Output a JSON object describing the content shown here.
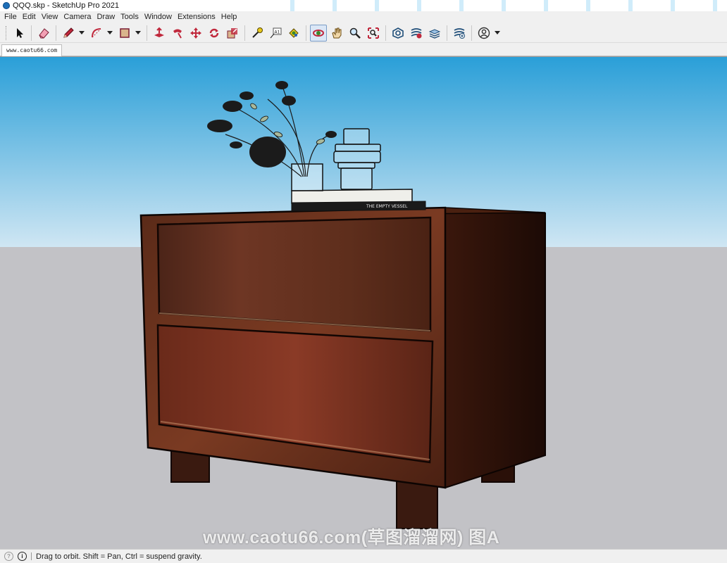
{
  "window": {
    "title": "QQQ.skp - SketchUp Pro 2021"
  },
  "menu": [
    "File",
    "Edit",
    "View",
    "Camera",
    "Draw",
    "Tools",
    "Window",
    "Extensions",
    "Help"
  ],
  "toolbar": {
    "tools": [
      "select",
      "eraser",
      "line",
      "arc",
      "shape",
      "push-pull",
      "follow-me",
      "move",
      "rotate",
      "scale",
      "tape-measure",
      "text",
      "paint-bucket",
      "orbit",
      "pan",
      "zoom",
      "zoom-extents",
      "3d-warehouse",
      "extension-warehouse",
      "layout",
      "extension-manager",
      "account"
    ],
    "active_tool": "orbit"
  },
  "scene_tab": {
    "label": "www.caotu66.com"
  },
  "viewport": {
    "sky_top": "#2a9fd8",
    "sky_bottom": "#cfe6f3",
    "ground": "#c2c2c6",
    "book_spine_text": "THE EMPTY VESSEL"
  },
  "watermark": "www.caotu66.com(草图溜溜网) 图A",
  "status": {
    "message": "Drag to orbit. Shift = Pan, Ctrl = suspend gravity."
  }
}
